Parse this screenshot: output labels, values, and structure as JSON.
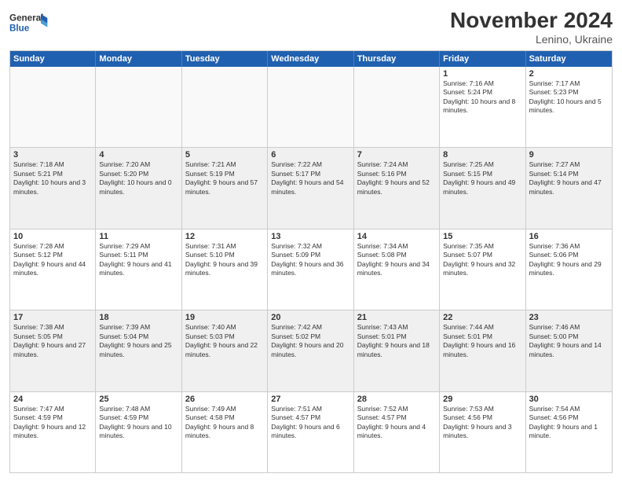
{
  "logo": {
    "line1": "General",
    "line2": "Blue"
  },
  "title": "November 2024",
  "location": "Lenino, Ukraine",
  "weekdays": [
    "Sunday",
    "Monday",
    "Tuesday",
    "Wednesday",
    "Thursday",
    "Friday",
    "Saturday"
  ],
  "rows": [
    [
      {
        "day": "",
        "text": ""
      },
      {
        "day": "",
        "text": ""
      },
      {
        "day": "",
        "text": ""
      },
      {
        "day": "",
        "text": ""
      },
      {
        "day": "",
        "text": ""
      },
      {
        "day": "1",
        "text": "Sunrise: 7:16 AM\nSunset: 5:24 PM\nDaylight: 10 hours and 8 minutes."
      },
      {
        "day": "2",
        "text": "Sunrise: 7:17 AM\nSunset: 5:23 PM\nDaylight: 10 hours and 5 minutes."
      }
    ],
    [
      {
        "day": "3",
        "text": "Sunrise: 7:18 AM\nSunset: 5:21 PM\nDaylight: 10 hours and 3 minutes."
      },
      {
        "day": "4",
        "text": "Sunrise: 7:20 AM\nSunset: 5:20 PM\nDaylight: 10 hours and 0 minutes."
      },
      {
        "day": "5",
        "text": "Sunrise: 7:21 AM\nSunset: 5:19 PM\nDaylight: 9 hours and 57 minutes."
      },
      {
        "day": "6",
        "text": "Sunrise: 7:22 AM\nSunset: 5:17 PM\nDaylight: 9 hours and 54 minutes."
      },
      {
        "day": "7",
        "text": "Sunrise: 7:24 AM\nSunset: 5:16 PM\nDaylight: 9 hours and 52 minutes."
      },
      {
        "day": "8",
        "text": "Sunrise: 7:25 AM\nSunset: 5:15 PM\nDaylight: 9 hours and 49 minutes."
      },
      {
        "day": "9",
        "text": "Sunrise: 7:27 AM\nSunset: 5:14 PM\nDaylight: 9 hours and 47 minutes."
      }
    ],
    [
      {
        "day": "10",
        "text": "Sunrise: 7:28 AM\nSunset: 5:12 PM\nDaylight: 9 hours and 44 minutes."
      },
      {
        "day": "11",
        "text": "Sunrise: 7:29 AM\nSunset: 5:11 PM\nDaylight: 9 hours and 41 minutes."
      },
      {
        "day": "12",
        "text": "Sunrise: 7:31 AM\nSunset: 5:10 PM\nDaylight: 9 hours and 39 minutes."
      },
      {
        "day": "13",
        "text": "Sunrise: 7:32 AM\nSunset: 5:09 PM\nDaylight: 9 hours and 36 minutes."
      },
      {
        "day": "14",
        "text": "Sunrise: 7:34 AM\nSunset: 5:08 PM\nDaylight: 9 hours and 34 minutes."
      },
      {
        "day": "15",
        "text": "Sunrise: 7:35 AM\nSunset: 5:07 PM\nDaylight: 9 hours and 32 minutes."
      },
      {
        "day": "16",
        "text": "Sunrise: 7:36 AM\nSunset: 5:06 PM\nDaylight: 9 hours and 29 minutes."
      }
    ],
    [
      {
        "day": "17",
        "text": "Sunrise: 7:38 AM\nSunset: 5:05 PM\nDaylight: 9 hours and 27 minutes."
      },
      {
        "day": "18",
        "text": "Sunrise: 7:39 AM\nSunset: 5:04 PM\nDaylight: 9 hours and 25 minutes."
      },
      {
        "day": "19",
        "text": "Sunrise: 7:40 AM\nSunset: 5:03 PM\nDaylight: 9 hours and 22 minutes."
      },
      {
        "day": "20",
        "text": "Sunrise: 7:42 AM\nSunset: 5:02 PM\nDaylight: 9 hours and 20 minutes."
      },
      {
        "day": "21",
        "text": "Sunrise: 7:43 AM\nSunset: 5:01 PM\nDaylight: 9 hours and 18 minutes."
      },
      {
        "day": "22",
        "text": "Sunrise: 7:44 AM\nSunset: 5:01 PM\nDaylight: 9 hours and 16 minutes."
      },
      {
        "day": "23",
        "text": "Sunrise: 7:46 AM\nSunset: 5:00 PM\nDaylight: 9 hours and 14 minutes."
      }
    ],
    [
      {
        "day": "24",
        "text": "Sunrise: 7:47 AM\nSunset: 4:59 PM\nDaylight: 9 hours and 12 minutes."
      },
      {
        "day": "25",
        "text": "Sunrise: 7:48 AM\nSunset: 4:59 PM\nDaylight: 9 hours and 10 minutes."
      },
      {
        "day": "26",
        "text": "Sunrise: 7:49 AM\nSunset: 4:58 PM\nDaylight: 9 hours and 8 minutes."
      },
      {
        "day": "27",
        "text": "Sunrise: 7:51 AM\nSunset: 4:57 PM\nDaylight: 9 hours and 6 minutes."
      },
      {
        "day": "28",
        "text": "Sunrise: 7:52 AM\nSunset: 4:57 PM\nDaylight: 9 hours and 4 minutes."
      },
      {
        "day": "29",
        "text": "Sunrise: 7:53 AM\nSunset: 4:56 PM\nDaylight: 9 hours and 3 minutes."
      },
      {
        "day": "30",
        "text": "Sunrise: 7:54 AM\nSunset: 4:56 PM\nDaylight: 9 hours and 1 minute."
      }
    ]
  ]
}
